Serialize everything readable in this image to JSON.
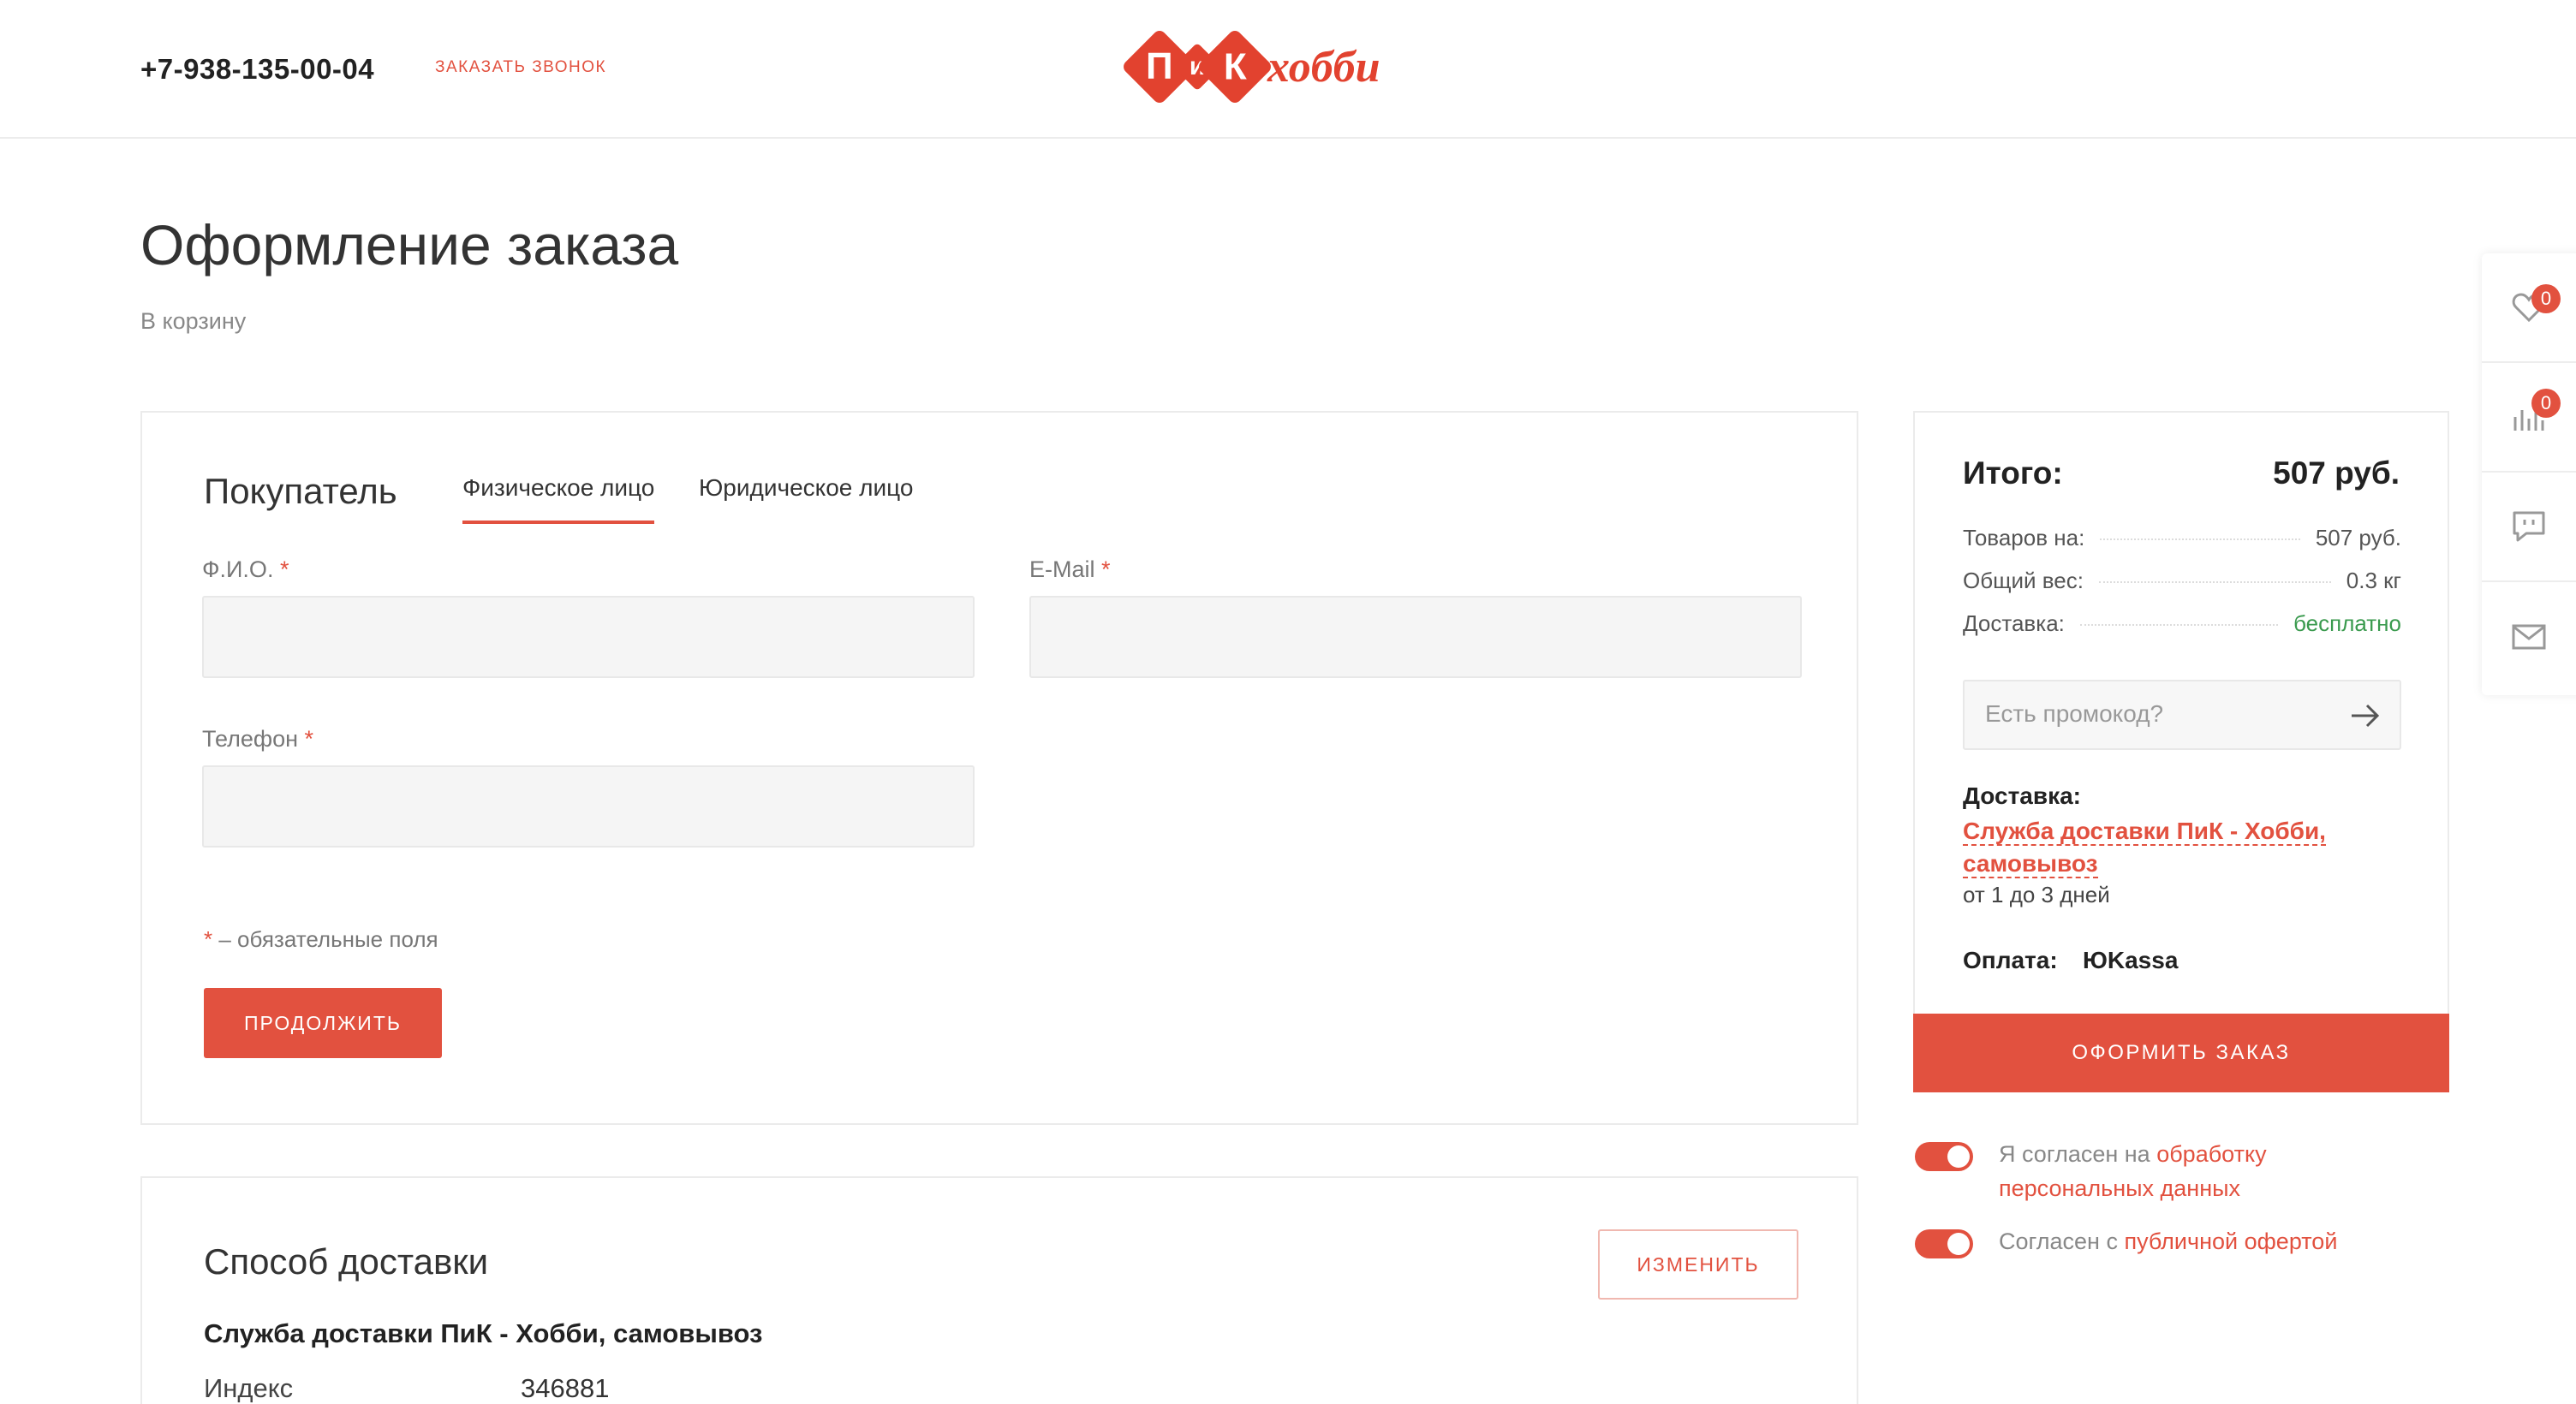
{
  "header": {
    "phone": "+7-938-135-00-04",
    "callback_label": "ЗАКАЗАТЬ ЗВОНОК",
    "logo": {
      "letter1": "П",
      "letter2": "и",
      "letter3": "К",
      "text": "хобби"
    }
  },
  "page": {
    "title": "Оформление заказа",
    "back_link": "В корзину"
  },
  "buyer": {
    "title": "Покупатель",
    "tabs": [
      {
        "label": "Физическое лицо",
        "active": true
      },
      {
        "label": "Юридическое лицо",
        "active": false
      }
    ],
    "fields": {
      "fio": {
        "label": "Ф.И.О.",
        "value": "",
        "required_mark": "*"
      },
      "email": {
        "label": "E-Mail",
        "value": "",
        "required_mark": "*"
      },
      "phone": {
        "label": "Телефон",
        "value": "",
        "required_mark": "*"
      }
    },
    "required_note_mark": "*",
    "required_note": " – обязательные поля",
    "continue_label": "ПРОДОЛЖИТЬ"
  },
  "delivery_method": {
    "title": "Способ доставки",
    "change_label": "ИЗМЕНИТЬ",
    "service": "Служба доставки ПиК - Хобби, самовывоз",
    "index_label": "Индекс",
    "index_value": "346881"
  },
  "summary": {
    "total_label": "Итого:",
    "total_value": "507 руб.",
    "rows": [
      {
        "label": "Товаров на:",
        "value": "507 руб."
      },
      {
        "label": "Общий вес:",
        "value": "0.3 кг"
      },
      {
        "label": "Доставка:",
        "value": "бесплатно"
      }
    ],
    "promo_placeholder": "Есть промокод?",
    "delivery_label": "Доставка:",
    "delivery_link": "Служба доставки ПиК - Хобби, самовывоз",
    "delivery_time": "от 1 до 3 дней",
    "payment_label": "Оплата:",
    "payment_value": "ЮKassa",
    "order_button": "ОФОРМИТЬ ЗАКАЗ"
  },
  "consents": [
    {
      "prefix": "Я согласен на ",
      "link": "обработку персональных данных",
      "checked": true
    },
    {
      "prefix": "Согласен с ",
      "link": "публичной офертой",
      "checked": true
    }
  ],
  "side_panel": {
    "favorites_count": "0",
    "compare_count": "0"
  },
  "colors": {
    "accent": "#e2513f",
    "free_delivery": "#3a9a4e"
  },
  "icons": [
    "heart-icon",
    "compare-icon",
    "chat-icon",
    "mail-icon",
    "arrow-right-icon"
  ]
}
